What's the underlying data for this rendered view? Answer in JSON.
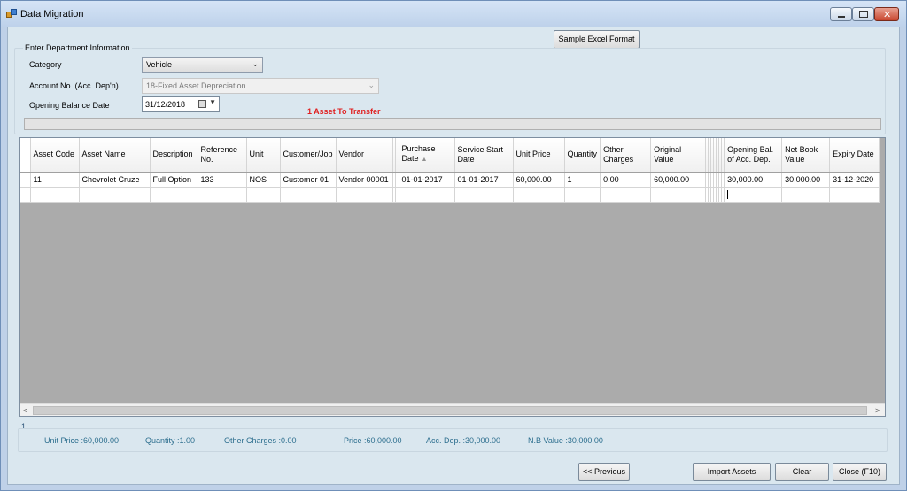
{
  "window": {
    "title": "Data Migration"
  },
  "toolbar": {
    "sample_excel_label": "Sample Excel Format"
  },
  "department": {
    "group_label": "Enter Department Information",
    "category_label": "Category",
    "category_value": "Vehicle",
    "account_label": "Account No. (Acc. Dep'n)",
    "account_value": "18-Fixed Asset Depreciation",
    "opening_date_label": "Opening Balance Date",
    "opening_date_value": "31/12/2018"
  },
  "status": {
    "transfer_message": "1 Asset To Transfer",
    "progress": 0
  },
  "grid": {
    "columns": [
      {
        "key": "asset_code",
        "label": "Asset Code"
      },
      {
        "key": "asset_name",
        "label": "Asset Name"
      },
      {
        "key": "description",
        "label": "Description"
      },
      {
        "key": "reference_no",
        "label": "Reference No."
      },
      {
        "key": "unit",
        "label": "Unit"
      },
      {
        "key": "customer_job",
        "label": "Customer/Job"
      },
      {
        "key": "vendor",
        "label": "Vendor"
      },
      {
        "key": "purchase_date",
        "label": "Purchase Date"
      },
      {
        "key": "service_start_date",
        "label": "Service Start Date"
      },
      {
        "key": "unit_price",
        "label": "Unit Price"
      },
      {
        "key": "quantity",
        "label": "Quantity"
      },
      {
        "key": "other_charges",
        "label": "Other Charges"
      },
      {
        "key": "original_value",
        "label": "Original Value"
      },
      {
        "key": "opening_bal_acc_dep",
        "label": "Opening Bal. of Acc. Dep."
      },
      {
        "key": "net_book_value",
        "label": "Net Book Value"
      },
      {
        "key": "expiry_date",
        "label": "Expiry Date"
      }
    ],
    "rows": [
      [
        "11",
        "Chevrolet Cruze",
        "Full Option",
        "133",
        "NOS",
        "Customer 01",
        "Vendor 00001",
        "01-01-2017",
        "01-01-2017",
        "60,000.00",
        "1",
        "0.00",
        "60,000.00",
        "30,000.00",
        "30,000.00",
        "31-12-2020"
      ]
    ],
    "sorted_column": "purchase_date"
  },
  "summary": {
    "row_count": "1",
    "unit_price": "Unit Price :60,000.00",
    "quantity": "Quantity :1.00",
    "other_charges": "Other Charges :0.00",
    "price": "Price :60,000.00",
    "acc_dep": "Acc. Dep. :30,000.00",
    "nb_value": "N.B Value :30,000.00"
  },
  "actions": {
    "previous_label": "<< Previous",
    "import_label": "Import Assets",
    "clear_label": "Clear",
    "close_label": "Close (F10)"
  }
}
